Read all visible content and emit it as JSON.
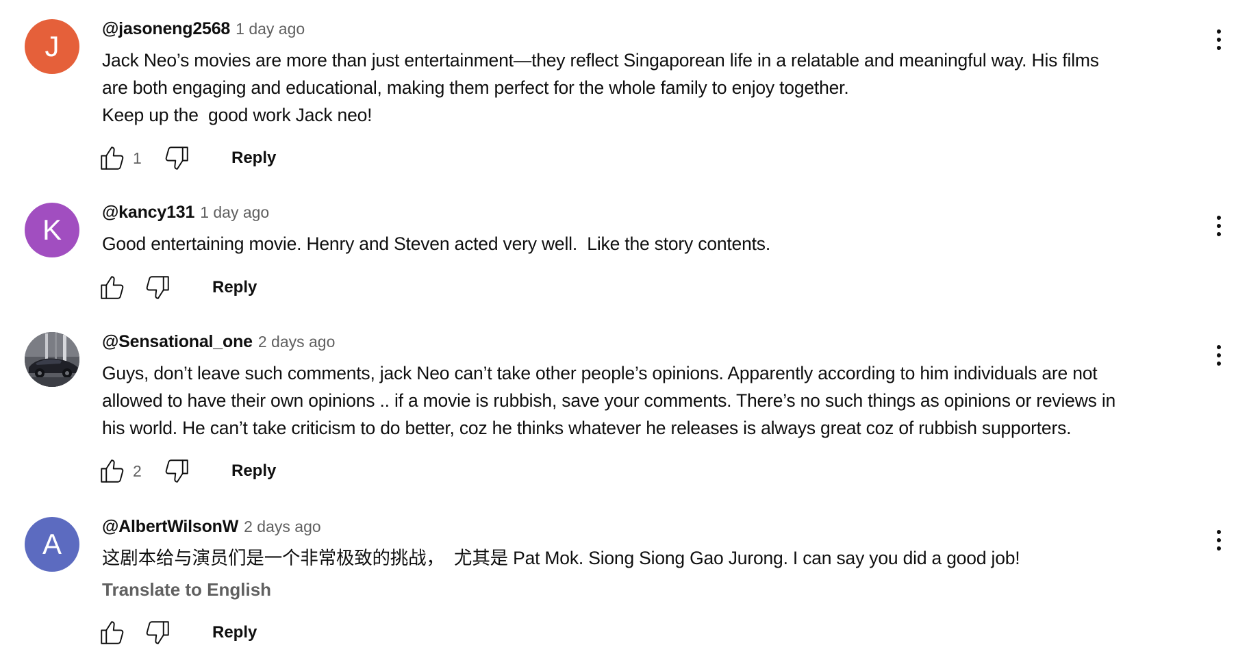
{
  "comments": [
    {
      "avatar_letter": "J",
      "avatar_color": "#e5603a",
      "author": "@jasoneng2568",
      "time": "1 day ago",
      "text": "Jack Neo’s movies are more than just entertainment—they reflect Singaporean life in a relatable and meaningful way. His films\nare both engaging and educational, making them perfect for the whole family to enjoy together.\nKeep up the  good work Jack neo!",
      "likes": "1",
      "reply_label": "Reply",
      "icons": {
        "like": "thumbs-up-icon",
        "dislike": "thumbs-down-icon",
        "more": "more-vert-icon"
      }
    },
    {
      "avatar_letter": "K",
      "avatar_color": "#a14ec0",
      "author": "@kancy131",
      "time": "1 day ago",
      "text": "Good entertaining movie. Henry and Steven acted very well.  Like the story contents.",
      "likes": "",
      "reply_label": "Reply",
      "icons": {
        "like": "thumbs-up-icon",
        "dislike": "thumbs-down-icon",
        "more": "more-vert-icon"
      }
    },
    {
      "avatar_letter": "",
      "avatar_color": "#4b4d55",
      "avatar_image": "car-photo-avatar",
      "author": "@Sensational_one",
      "time": "2 days ago",
      "text": "Guys, don’t leave such comments, jack Neo can’t take other people’s opinions. Apparently according to him individuals are not\nallowed to have their own opinions .. if a movie is rubbish, save your comments. There’s no such things as opinions or reviews in\nhis world. He can’t take criticism to do better, coz he thinks whatever he releases is always great coz of rubbish supporters.",
      "likes": "2",
      "reply_label": "Reply",
      "icons": {
        "like": "thumbs-up-icon",
        "dislike": "thumbs-down-icon",
        "more": "more-vert-icon"
      }
    },
    {
      "avatar_letter": "A",
      "avatar_color": "#5c6bc0",
      "author": "@AlbertWilsonW",
      "time": "2 days ago",
      "text": "这剧本给与演员们是一个非常极致的挑战，  尤其是 Pat Mok. Siong Siong Gao Jurong. I can say you did a good job!",
      "translate_label": "Translate to English",
      "likes": "",
      "reply_label": "Reply",
      "icons": {
        "like": "thumbs-up-icon",
        "dislike": "thumbs-down-icon",
        "more": "more-vert-icon"
      }
    }
  ]
}
